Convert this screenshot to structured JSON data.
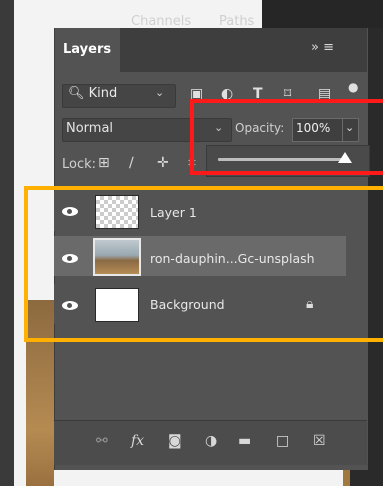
{
  "panel": {
    "tabs": [
      {
        "label": "Layers",
        "active": true
      },
      {
        "label": "Channels",
        "active": false
      },
      {
        "label": "Paths",
        "active": false
      }
    ],
    "menu_glyph": "»  ≡"
  },
  "filter": {
    "kind_label": "Kind",
    "icons": [
      "image-filter-icon",
      "adjustment-filter-icon",
      "type-filter-icon",
      "shape-filter-icon",
      "smart-object-filter-icon",
      "filter-toggle-icon"
    ]
  },
  "blend": {
    "mode": "Normal",
    "opacity_label": "Opacity:",
    "opacity_value": "100%"
  },
  "lock": {
    "label": "Lock:",
    "icons": [
      "lock-transparent-icon",
      "lock-image-icon",
      "lock-position-icon",
      "lock-artboard-icon"
    ]
  },
  "slider": {
    "value_percent": 100
  },
  "layers": [
    {
      "name": "Layer 1",
      "visible": true,
      "selected": false,
      "locked": false
    },
    {
      "name": "ron-dauphin...Gc-unsplash",
      "visible": true,
      "selected": true,
      "locked": false
    },
    {
      "name": "Background",
      "visible": true,
      "selected": false,
      "locked": true
    }
  ],
  "toolbar_icons": [
    "link-icon",
    "fx-icon",
    "mask-icon",
    "adjustment-icon",
    "folder-icon",
    "new-layer-icon",
    "trash-icon"
  ],
  "colors": {
    "panel": "#535353",
    "annotation_red": "#ff1a1a",
    "annotation_orange": "#ffb000"
  }
}
